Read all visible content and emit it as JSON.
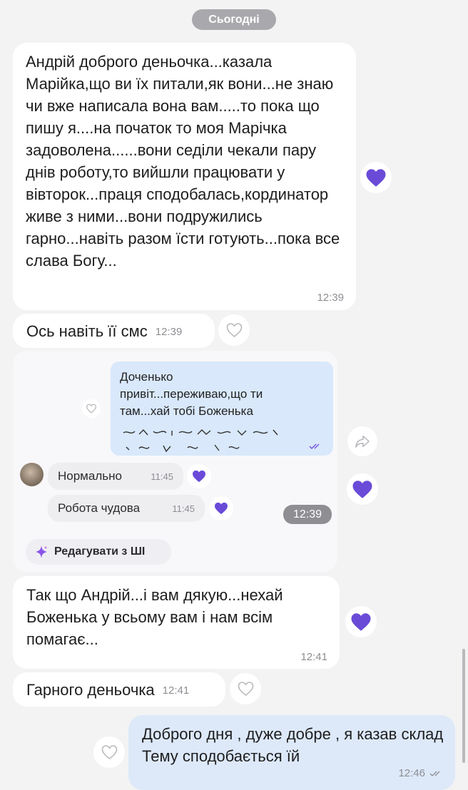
{
  "date_label": "Сьогодні",
  "messages": [
    {
      "text": "Андрій доброго деньочка...казала Марійка,що ви їх питали,як вони...не знаю чи вже написала вона вам.....то пока що пишу я....на початок то моя Марічка задоволена......вони седіли чекали пару днів роботу,то вийшли працювати у вівторок...праця сподобалась,кординатор живе з ними...вони подружились гарно...навіть разом їсти готують...пока все слава Богу...",
      "time": "12:39"
    },
    {
      "text": "Ось навіть її смс",
      "time": "12:39"
    },
    {
      "text": "Так що Андрій...і вам дякую...нехай Боженька у всьому вам і нам всім помагає...",
      "time": "12:41"
    },
    {
      "text": "Гарного деньочка",
      "time": "12:41"
    },
    {
      "text": "Доброго дня , дуже добре , я казав склад Тему сподобається їй",
      "time": "12:46"
    }
  ],
  "shared_image": {
    "bubble_text": "Доченько привіт...переживаю,що ти там...хай тобі Боженька",
    "replies": [
      {
        "text": "Нормально",
        "time": "11:45"
      },
      {
        "text": "Робота чудова",
        "time": "11:45"
      }
    ],
    "time": "12:39"
  },
  "ai_edit_label": "Редагувати з ШІ",
  "colors": {
    "accent_purple": "#6a4bd8",
    "outgoing_bubble": "#dde9f9",
    "background": "#f3f3f4"
  },
  "icons": [
    "heart-filled-icon",
    "heart-outline-icon",
    "forward-icon",
    "sparkle-icon",
    "double-check-icon"
  ]
}
